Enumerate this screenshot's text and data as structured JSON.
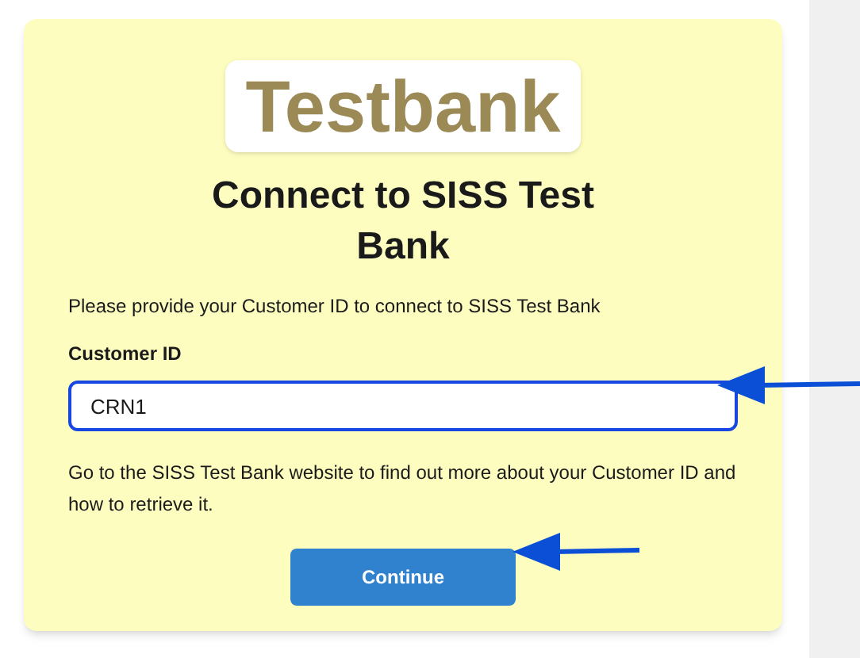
{
  "logo": {
    "text": "Testbank"
  },
  "title": "Connect to SISS Test Bank",
  "intro": "Please provide your Customer ID to connect to SISS Test Bank",
  "field": {
    "label": "Customer ID",
    "value": "CRN1"
  },
  "help": "Go to the SISS Test Bank website to find out more about your Customer ID and how to retrieve it.",
  "button": "Continue"
}
